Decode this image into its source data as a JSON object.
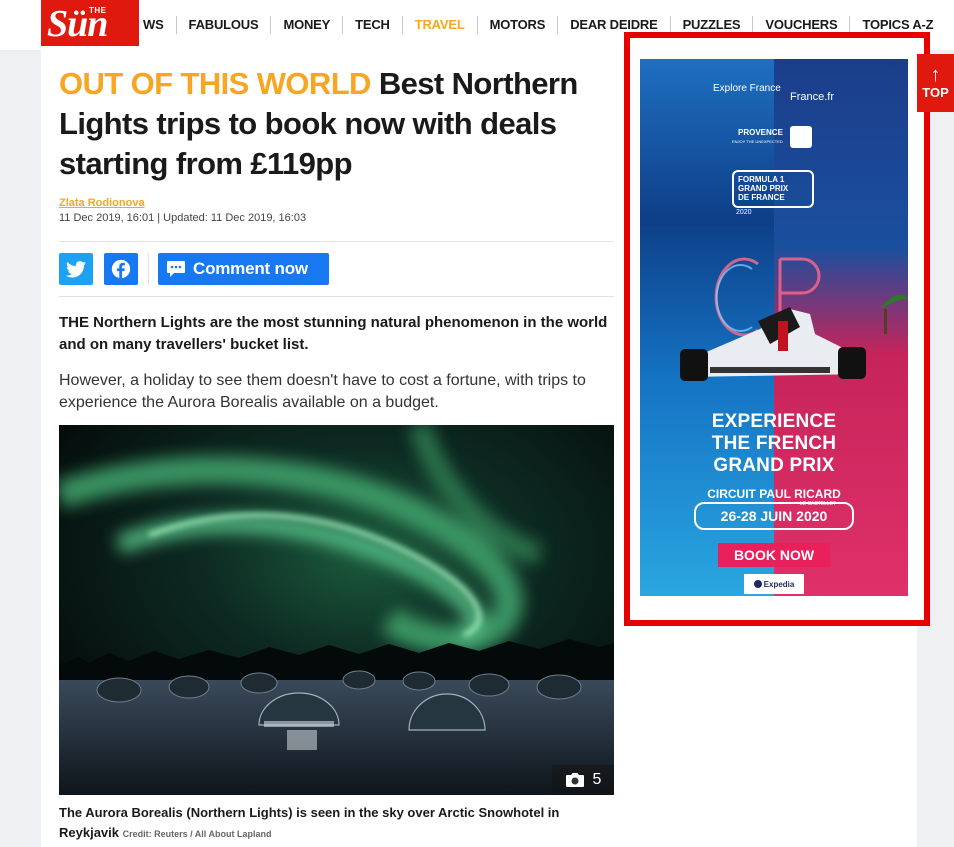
{
  "nav": {
    "logo_small": "THE",
    "logo_word": "Sün",
    "items": [
      "WS",
      "FABULOUS",
      "MONEY",
      "TECH",
      "TRAVEL",
      "MOTORS",
      "DEAR DEIDRE",
      "PUZZLES",
      "VOUCHERS",
      "TOPICS A-Z"
    ],
    "active_item": "TRAVEL"
  },
  "article": {
    "kicker": "OUT OF THIS WORLD",
    "headline": "Best Northern Lights trips to book now with deals starting from £119pp",
    "author": "Zlata Rodionova",
    "dates": "11 Dec 2019, 16:01 | Updated: 11 Dec 2019, 16:03",
    "comment_label": "Comment now",
    "lead": "THE Northern Lights are the most stunning natural phenomenon in the world and on many travellers' bucket list.",
    "paragraph": "However, a holiday to see them doesn't have to cost a fortune, with trips to experience the Aurora Borealis available on a budget.",
    "photo_count": "5",
    "caption": "The Aurora Borealis (Northern Lights) is seen in the sky over Arctic Snowhotel in Reykjavik",
    "credit": "Credit: Reuters / All About Lapland"
  },
  "ad": {
    "explore_brand": "Explore France",
    "site_brand": "France.fr",
    "region_name": "PROVENCE",
    "region_tagline": "ENJOY THE UNEXPECTED",
    "event_logo_line1": "FORMULA 1",
    "event_logo_line2": "GRAND PRIX",
    "event_logo_line3": "DE FRANCE",
    "event_logo_year": "2020",
    "headline_line1": "EXPERIENCE",
    "headline_line2": "THE FRENCH",
    "headline_line3": "GRAND PRIX",
    "circuit": "CIRCUIT PAUL RICARD",
    "circuit_sub": "LE CASTELLET",
    "dates": "26-28 JUIN 2020",
    "cta": "BOOK NOW",
    "sponsor": "Expedia"
  },
  "back_to_top": {
    "label": "TOP"
  },
  "colors": {
    "brand_red": "#e0190f",
    "accent_orange": "#f6a623",
    "share_blue": "#1778f2",
    "twitter_blue": "#1da1f2",
    "ad_highlight": "#e60000"
  },
  "icons": {
    "twitter": "twitter-icon",
    "facebook": "facebook-icon",
    "comment": "speech-bubble-icon",
    "camera": "camera-icon",
    "arrow_up": "arrow-up-icon"
  }
}
